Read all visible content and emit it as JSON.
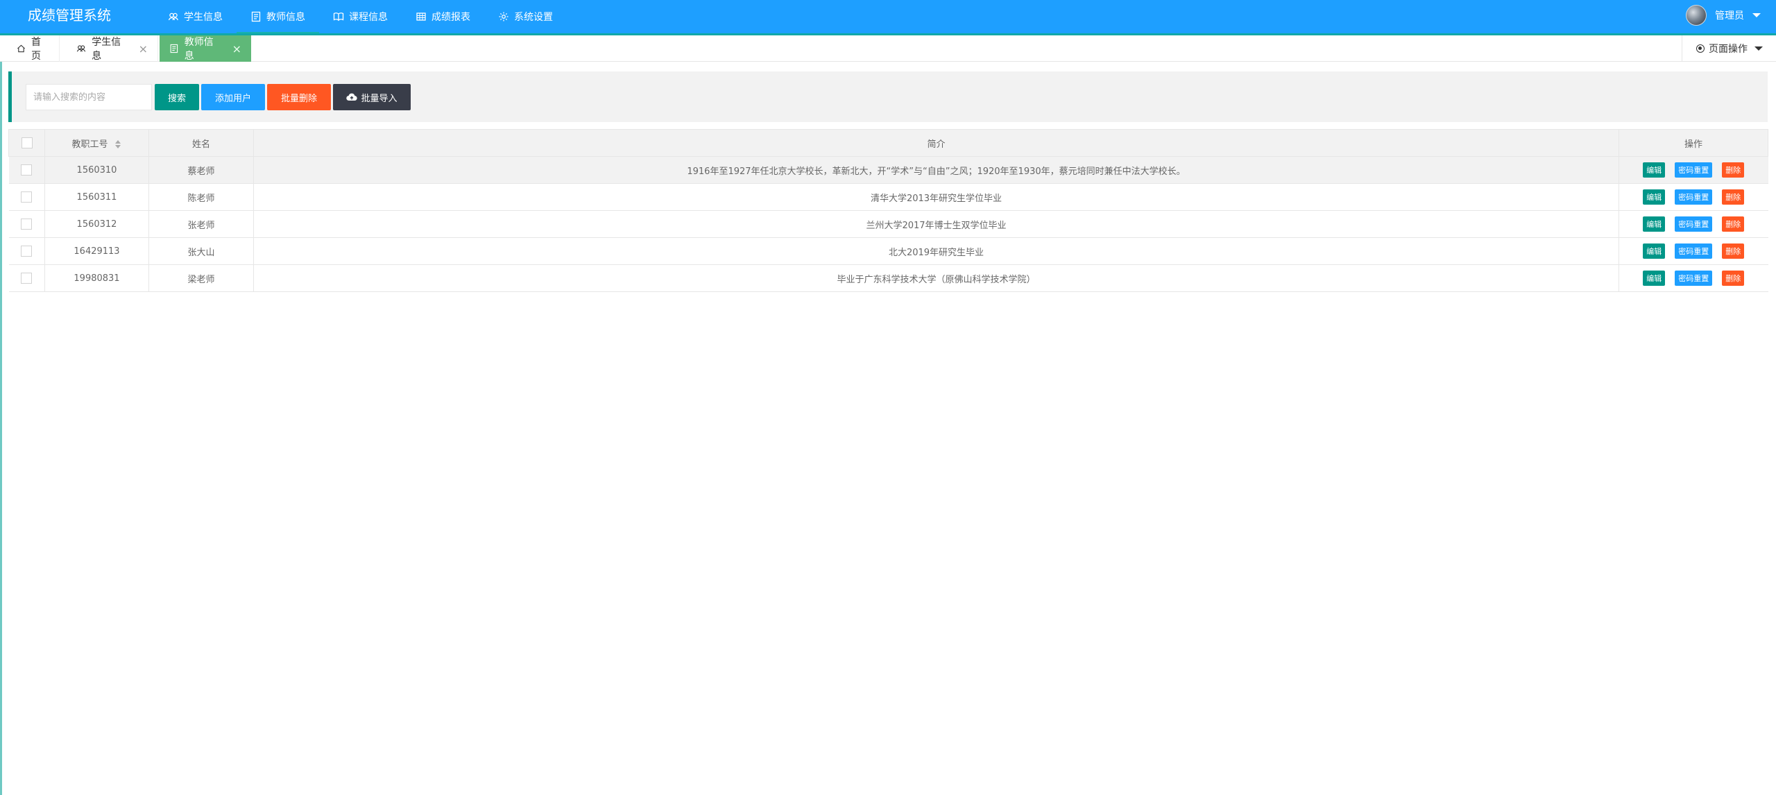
{
  "app": {
    "title": "成绩管理系统"
  },
  "nav": {
    "items": [
      {
        "label": "学生信息",
        "icon": "users-icon"
      },
      {
        "label": "教师信息",
        "icon": "form-icon"
      },
      {
        "label": "课程信息",
        "icon": "book-icon"
      },
      {
        "label": "成绩报表",
        "icon": "table-icon"
      },
      {
        "label": "系统设置",
        "icon": "gear-icon"
      }
    ],
    "active_index": 1
  },
  "user": {
    "name": "管理员"
  },
  "tabs": [
    {
      "label": "首页",
      "icon": "home-icon",
      "closable": false
    },
    {
      "label": "学生信息",
      "icon": "users-icon",
      "closable": true
    },
    {
      "label": "教师信息",
      "icon": "form-icon",
      "closable": true,
      "active": true
    }
  ],
  "page_ops": {
    "label": "页面操作"
  },
  "toolbar": {
    "search_placeholder": "请输入搜索的内容",
    "search_button": "搜索",
    "add_button": "添加用户",
    "batch_delete_button": "批量删除",
    "batch_import_button": "批量导入"
  },
  "table": {
    "headers": {
      "id": "教职工号",
      "name": "姓名",
      "intro": "简介",
      "ops": "操作"
    },
    "rows": [
      {
        "id": "1560310",
        "name": "蔡老师",
        "intro": "1916年至1927年任北京大学校长，革新北大，开“学术”与“自由”之风；1920年至1930年，蔡元培同时兼任中法大学校长。"
      },
      {
        "id": "1560311",
        "name": "陈老师",
        "intro": "清华大学2013年研究生学位毕业"
      },
      {
        "id": "1560312",
        "name": "张老师",
        "intro": "兰州大学2017年博士生双学位毕业"
      },
      {
        "id": "16429113",
        "name": "张大山",
        "intro": "北大2019年研究生毕业"
      },
      {
        "id": "19980831",
        "name": "梁老师",
        "intro": "毕业于广东科学技术大学（原佛山科学技术学院）"
      }
    ],
    "row_actions": {
      "edit": "编辑",
      "reset": "密码重置",
      "delete": "删除"
    }
  },
  "colors": {
    "header": "#1e9fff",
    "accent_green": "#009688",
    "tab_active": "#5fb878",
    "danger": "#ff5722",
    "dark": "#393d49"
  }
}
